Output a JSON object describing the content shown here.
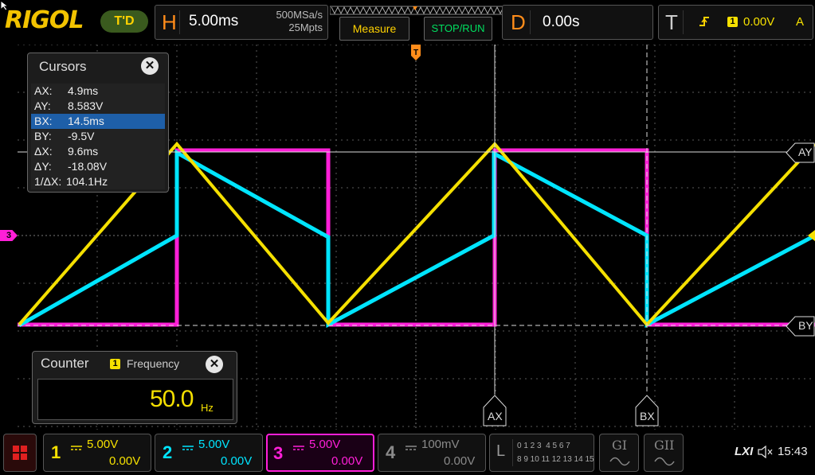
{
  "brand": {
    "logo": "RIGOL",
    "mode": "T'D"
  },
  "horizontal": {
    "letter": "H",
    "timebase": "5.00ms",
    "sample_rate": "500MSa/s",
    "memory_depth": "25Mpts"
  },
  "toolbar": {
    "measure_label": "Measure",
    "stop_run_label": "STOP/RUN"
  },
  "delay": {
    "letter": "D",
    "value": "0.00s"
  },
  "trigger": {
    "letter": "T",
    "source": "1",
    "level": "0.00V",
    "mode": "A"
  },
  "cursors": {
    "title": "Cursors",
    "rows": [
      {
        "key": "AX:",
        "value": "4.9ms"
      },
      {
        "key": "AY:",
        "value": "8.583V"
      },
      {
        "key": "BX:",
        "value": "14.5ms"
      },
      {
        "key": "BY:",
        "value": "-9.5V"
      },
      {
        "key": "ΔX:",
        "value": "9.6ms"
      },
      {
        "key": "ΔY:",
        "value": "-18.08V"
      },
      {
        "key": "1/ΔX:",
        "value": "104.1Hz"
      }
    ],
    "selected_index": 2,
    "markers": {
      "ax": "AX",
      "bx": "BX",
      "ay": "AY",
      "by": "BY"
    }
  },
  "counter": {
    "title": "Counter",
    "source": "1",
    "label": "Frequency",
    "value": "50.0",
    "unit": "Hz"
  },
  "ch3_marker": "3",
  "channels": [
    {
      "num": "1",
      "scale": "5.00V",
      "offset": "0.00V",
      "color": "#f5e000",
      "active": false
    },
    {
      "num": "2",
      "scale": "5.00V",
      "offset": "0.00V",
      "color": "#00e5ff",
      "active": false
    },
    {
      "num": "3",
      "scale": "5.00V",
      "offset": "0.00V",
      "color": "#ff1fd8",
      "active": true
    },
    {
      "num": "4",
      "scale": "100mV",
      "offset": "0.00V",
      "color": "#8a8a8a",
      "active": false
    }
  ],
  "logic": {
    "letter": "L",
    "row1": "0 1 2 3  4 5 6 7",
    "row2": "8 9 10 11 12 13 14 15"
  },
  "generators": {
    "g1": "GI",
    "g2": "GII"
  },
  "status": {
    "lxi": "LXI",
    "time": "15:43"
  },
  "colors": {
    "ch1": "#f5e000",
    "ch2": "#00e5ff",
    "ch3": "#ff1fd8",
    "accent": "#ff8c1a"
  }
}
